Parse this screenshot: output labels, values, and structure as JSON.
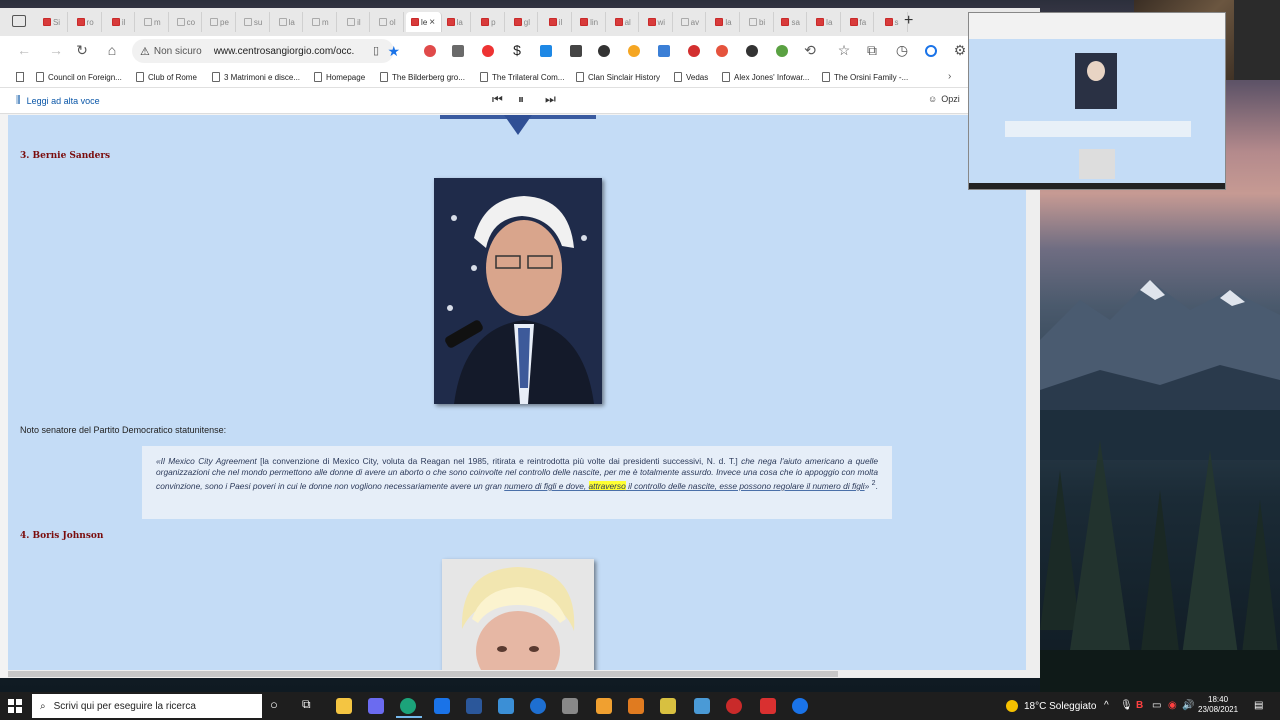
{
  "browser": {
    "address": {
      "security_label": "Non sicuro",
      "url": "www.centrosangiorgio.com/occ..."
    },
    "tabs": [
      "Si",
      "ro",
      "il",
      "m",
      "co",
      "pe",
      "su",
      "la",
      "m",
      "il",
      "ol",
      "le",
      "la",
      "p",
      "gl",
      "il",
      "lin",
      "al",
      "wi",
      "av",
      "la",
      "bi",
      "sa",
      "la",
      "fa",
      "s"
    ],
    "bookmarks": [
      "Council on Foreign...",
      "Club of Rome",
      "3 Matrimoni e disce...",
      "Homepage",
      "The Bilderberg gro...",
      "The Trilateral Com...",
      "Clan Sinclair History",
      "Vedas",
      "Alex Jones' Infowar...",
      "The Orsini Family -..."
    ],
    "readbar": {
      "read_aloud": "Leggi ad alta voce",
      "options": "Opzi"
    }
  },
  "page": {
    "section1": {
      "heading": "3. Bernie Sanders"
    },
    "bio": "Noto senatore del Partito Democratico statunitense:",
    "quote": {
      "open": "«",
      "term": "Il Mexico City Agreement",
      "bracket": " [la convenzione di Mexico City, voluta da Reagan nel 1985, ritirata e reintrodotta più volte dai presidenti successivi, N. d. T.] ",
      "part1": "che nega l'aiuto americano a quelle organizzazioni che nel mondo permettono alle donne di avere un aborto o che sono coinvolte nel controllo delle nascite, per me è totalmente assurdo. Invece una cosa che io appoggio con molta convinzione, sono i Paesi poveri in cui le donne non vogliono necessariamente avere un gran ",
      "underlined": "numero di figli e dove, ",
      "highlight": "attraverso",
      "underlined2": " il controllo delle nascite, esse possono regolare il numero di figli",
      "close": "» ",
      "footnote": "2",
      "end": "."
    },
    "section2": {
      "heading": "4. Boris Johnson"
    }
  },
  "taskbar": {
    "search_placeholder": "Scrivi qui per eseguire la ricerca",
    "weather": "18°C Soleggiato",
    "time": "18:40",
    "date": "23/08/2021"
  },
  "colors": {
    "page_bg": "#c4dcf6",
    "heading": "#7a0c0c",
    "highlight": "#ffff33",
    "taskbar": "#1e1e1e"
  }
}
